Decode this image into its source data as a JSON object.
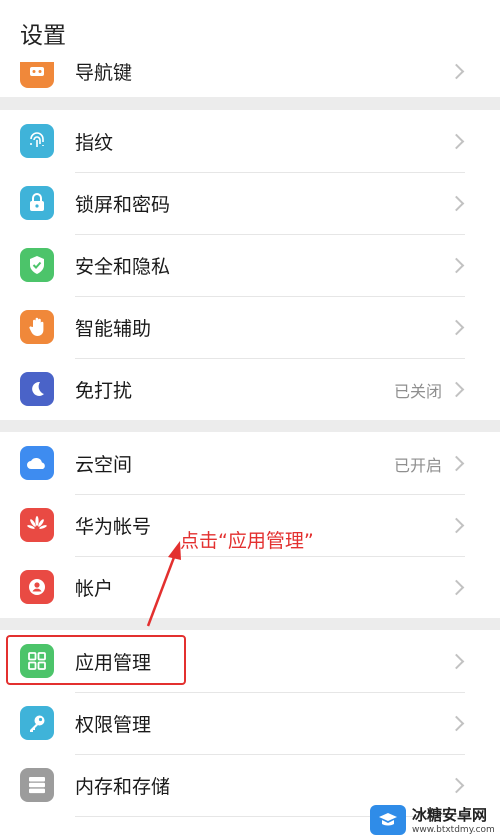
{
  "header": {
    "title": "设置"
  },
  "groups": [
    {
      "rows": [
        {
          "label": "导航键",
          "icon": "navigation-key-icon",
          "color": "#f0883a",
          "value": ""
        }
      ]
    },
    {
      "rows": [
        {
          "label": "指纹",
          "icon": "fingerprint-icon",
          "color": "#3fb3d9",
          "value": ""
        },
        {
          "label": "锁屏和密码",
          "icon": "lock-icon",
          "color": "#3fb3d9",
          "value": ""
        },
        {
          "label": "安全和隐私",
          "icon": "shield-check-icon",
          "color": "#4cc46a",
          "value": ""
        },
        {
          "label": "智能辅助",
          "icon": "hand-icon",
          "color": "#f0883a",
          "value": ""
        },
        {
          "label": "免打扰",
          "icon": "moon-icon",
          "color": "#4a63c8",
          "value": "已关闭"
        }
      ]
    },
    {
      "rows": [
        {
          "label": "云空间",
          "icon": "cloud-icon",
          "color": "#3e8cf0",
          "value": "已开启"
        },
        {
          "label": "华为帐号",
          "icon": "huawei-logo-icon",
          "color": "#e94a43",
          "value": ""
        },
        {
          "label": "帐户",
          "icon": "account-icon",
          "color": "#e94a43",
          "value": ""
        }
      ]
    },
    {
      "rows": [
        {
          "label": "应用管理",
          "icon": "app-grid-icon",
          "color": "#4cc46a",
          "value": ""
        },
        {
          "label": "权限管理",
          "icon": "key-icon",
          "color": "#3fb3d9",
          "value": ""
        },
        {
          "label": "内存和存储",
          "icon": "storage-icon",
          "color": "#9c9c9c",
          "value": ""
        }
      ]
    }
  ],
  "annotation": {
    "text": "点击“应用管理”",
    "color": "#e3302f"
  },
  "watermark": {
    "name": "冰糖安卓网",
    "url": "www.btxtdmy.com"
  }
}
